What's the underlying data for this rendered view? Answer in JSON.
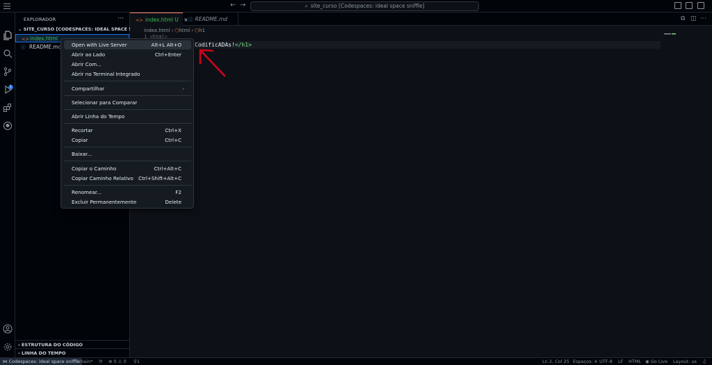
{
  "titlebar": {
    "search_text": "site_curso [Codespaces: ideal space sniffle]",
    "back_icon": "←",
    "forward_icon": "→"
  },
  "sidebar": {
    "header": "EXPLORADOR",
    "more": "···",
    "folder": "SITE_CURSO [CODESPACES: IDEAL SPACE SNIFFLE]",
    "files": [
      {
        "name": "index.html",
        "icon": "<>",
        "selected": true
      },
      {
        "name": "README.md",
        "icon": "ⓘ",
        "selected": false
      }
    ],
    "sections": [
      "ESTRUTURA DO CÓDIGO",
      "LINHA DO TEMPO"
    ]
  },
  "activity": {
    "scm_badge": "1"
  },
  "tabs": [
    {
      "label": "index.html",
      "modified": "U",
      "close": "×",
      "icon": "<>"
    },
    {
      "label": "README.md",
      "icon": "ⓘ"
    }
  ],
  "breadcrumb": {
    "file": "index.html",
    "elements": [
      "html",
      "h1"
    ],
    "line1": "1   <html>"
  },
  "code": {
    "text": "CodificADAs!",
    "close_tag": "</h1>"
  },
  "context_menu": {
    "items": [
      {
        "label": "Open with Live Server",
        "shortcut": "Alt+L Alt+O",
        "highlighted": true
      },
      {
        "label": "Abrir ao Lado",
        "shortcut": "Ctrl+Enter"
      },
      {
        "label": "Abrir Com...",
        "shortcut": ""
      },
      {
        "label": "Abrir no Terminal Integrado",
        "shortcut": ""
      },
      {
        "label": "Compartilhar",
        "shortcut": "",
        "submenu": "›"
      },
      {
        "label": "Selecionar para Comparar",
        "shortcut": ""
      },
      {
        "label": "Abrir Linha do Tempo",
        "shortcut": ""
      },
      {
        "label": "Recortar",
        "shortcut": "Ctrl+X"
      },
      {
        "label": "Copiar",
        "shortcut": "Ctrl+C"
      },
      {
        "label": "Baixar...",
        "shortcut": ""
      },
      {
        "label": "Copiar o Caminho",
        "shortcut": "Ctrl+Alt+C"
      },
      {
        "label": "Copiar Caminho Relativo",
        "shortcut": "Ctrl+Shift+Alt+C"
      },
      {
        "label": "Renomear...",
        "shortcut": "F2"
      },
      {
        "label": "Excluir Permanentemente",
        "shortcut": "Delete"
      }
    ]
  },
  "statusbar": {
    "remote": "Codespaces: ideal space sniffle",
    "branch": "main*",
    "sync": "⟳",
    "problems": "⊗ 0 ⚠ 0",
    "ports": "1",
    "position": "Ln 2, Col 25",
    "spaces": "Espaços: 4",
    "encoding": "UTF-8",
    "eol": "LF",
    "language": "HTML",
    "golive": "Go Live",
    "layout": "Layout: us"
  },
  "colors": {
    "accent_arrow": "#d0021b",
    "selection_border": "#1f6feb",
    "tag_green": "#7ee787"
  }
}
